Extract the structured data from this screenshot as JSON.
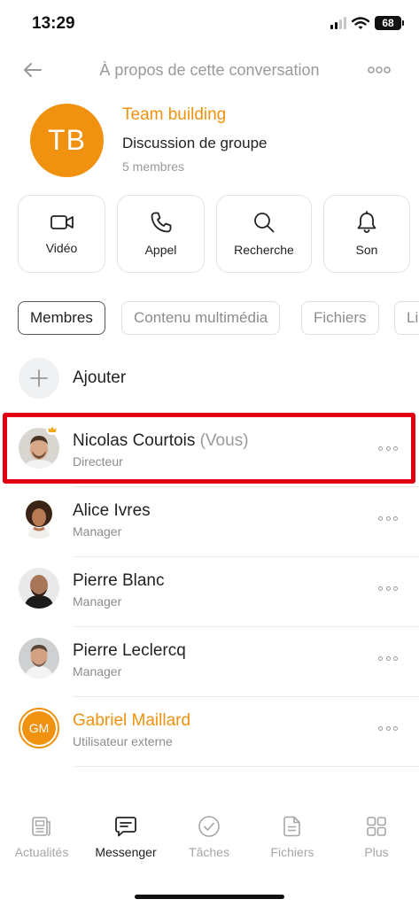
{
  "status_bar": {
    "time": "13:29",
    "battery": "68"
  },
  "header": {
    "title": "À propos de cette conversation"
  },
  "group": {
    "initials": "TB",
    "name": "Team building",
    "type": "Discussion de groupe",
    "count": "5 membres"
  },
  "actions": [
    {
      "label": "Vidéo",
      "icon": "video-icon"
    },
    {
      "label": "Appel",
      "icon": "phone-icon"
    },
    {
      "label": "Recherche",
      "icon": "search-icon"
    },
    {
      "label": "Son",
      "icon": "bell-icon"
    }
  ],
  "tabs": [
    "Membres",
    "Contenu multimédia",
    "Fichiers",
    "Li"
  ],
  "add_label": "Ajouter",
  "members": [
    {
      "name": "Nicolas Courtois",
      "suffix": "(Vous)",
      "role": "Directeur"
    },
    {
      "name": "Alice Ivres",
      "role": "Manager"
    },
    {
      "name": "Pierre Blanc",
      "role": "Manager"
    },
    {
      "name": "Pierre Leclercq",
      "role": "Manager"
    },
    {
      "name": "Gabriel Maillard",
      "initials": "GM",
      "role": "Utilisateur externe"
    }
  ],
  "nav": [
    {
      "label": "Actualités",
      "icon": "news-icon"
    },
    {
      "label": "Messenger",
      "icon": "chat-icon",
      "active": true
    },
    {
      "label": "Tâches",
      "icon": "check-icon"
    },
    {
      "label": "Fichiers",
      "icon": "file-icon"
    },
    {
      "label": "Plus",
      "icon": "grid-icon"
    }
  ],
  "colors": {
    "accent": "#f0920f",
    "highlight": "#e00012"
  }
}
